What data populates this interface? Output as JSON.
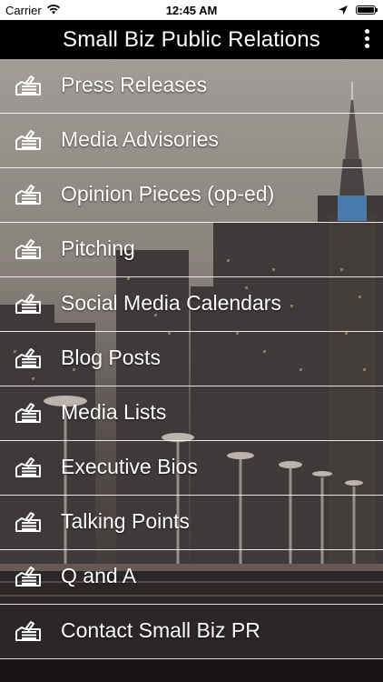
{
  "status_bar": {
    "carrier": "Carrier",
    "time": "12:45 AM"
  },
  "nav": {
    "title": "Small Biz Public Relations"
  },
  "menu": {
    "items": [
      {
        "label": "Press Releases"
      },
      {
        "label": "Media Advisories"
      },
      {
        "label": "Opinion Pieces (op-ed)"
      },
      {
        "label": "Pitching"
      },
      {
        "label": "Social Media Calendars"
      },
      {
        "label": "Blog Posts"
      },
      {
        "label": "Media Lists"
      },
      {
        "label": "Executive Bios"
      },
      {
        "label": "Talking Points"
      },
      {
        "label": "Q and A"
      },
      {
        "label": "Contact Small Biz PR"
      }
    ]
  },
  "icons": {
    "item_icon": "pencil-writing-icon",
    "more": "more-vertical-icon"
  }
}
